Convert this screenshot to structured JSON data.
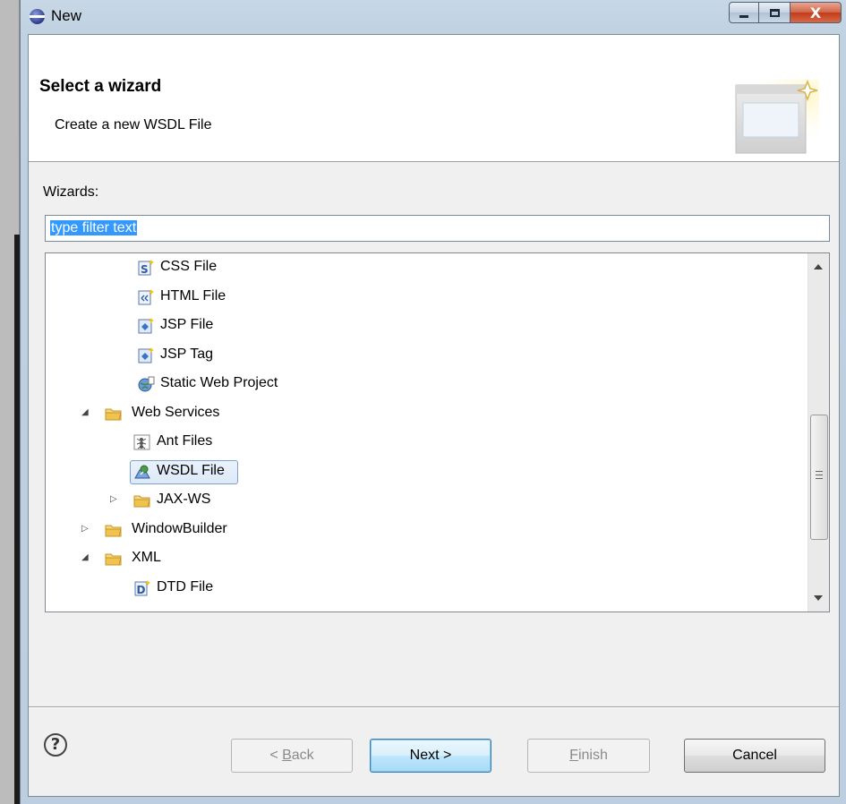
{
  "window": {
    "title": "New",
    "close_glyph": "X"
  },
  "header": {
    "title": "Select a wizard",
    "subtitle": "Create a new WSDL File"
  },
  "wizards": {
    "label": "Wizards:",
    "filter_value": "type filter text"
  },
  "tree": {
    "items": [
      {
        "label": "CSS File",
        "icon": "css-file-icon",
        "level": 2,
        "expander": ""
      },
      {
        "label": "HTML File",
        "icon": "html-file-icon",
        "level": 2,
        "expander": ""
      },
      {
        "label": "JSP File",
        "icon": "jsp-file-icon",
        "level": 2,
        "expander": ""
      },
      {
        "label": "JSP Tag",
        "icon": "jsp-tag-icon",
        "level": 2,
        "expander": ""
      },
      {
        "label": "Static Web Project",
        "icon": "static-web-project-icon",
        "level": 2,
        "expander": ""
      },
      {
        "label": "Web Services",
        "icon": "folder-icon",
        "level": 0,
        "expander": "expanded"
      },
      {
        "label": "Ant Files",
        "icon": "ant-icon",
        "level": 1,
        "expander": ""
      },
      {
        "label": "WSDL File",
        "icon": "wsdl-file-icon",
        "level": 1,
        "expander": "",
        "selected": true
      },
      {
        "label": "JAX-WS",
        "icon": "folder-icon",
        "level": 1,
        "expander": "collapsed"
      },
      {
        "label": "WindowBuilder",
        "icon": "folder-icon",
        "level": 0,
        "expander": "collapsed"
      },
      {
        "label": "XML",
        "icon": "folder-icon",
        "level": 0,
        "expander": "expanded"
      },
      {
        "label": "DTD File",
        "icon": "dtd-file-icon",
        "level": 1,
        "expander": ""
      }
    ]
  },
  "buttons": {
    "back": "< Back",
    "next": "Next >",
    "finish": "Finish",
    "cancel": "Cancel"
  },
  "colors": {
    "selection": "#3399ff",
    "tree_selection_border": "#7da2ce",
    "folder": "#f0c24e"
  }
}
